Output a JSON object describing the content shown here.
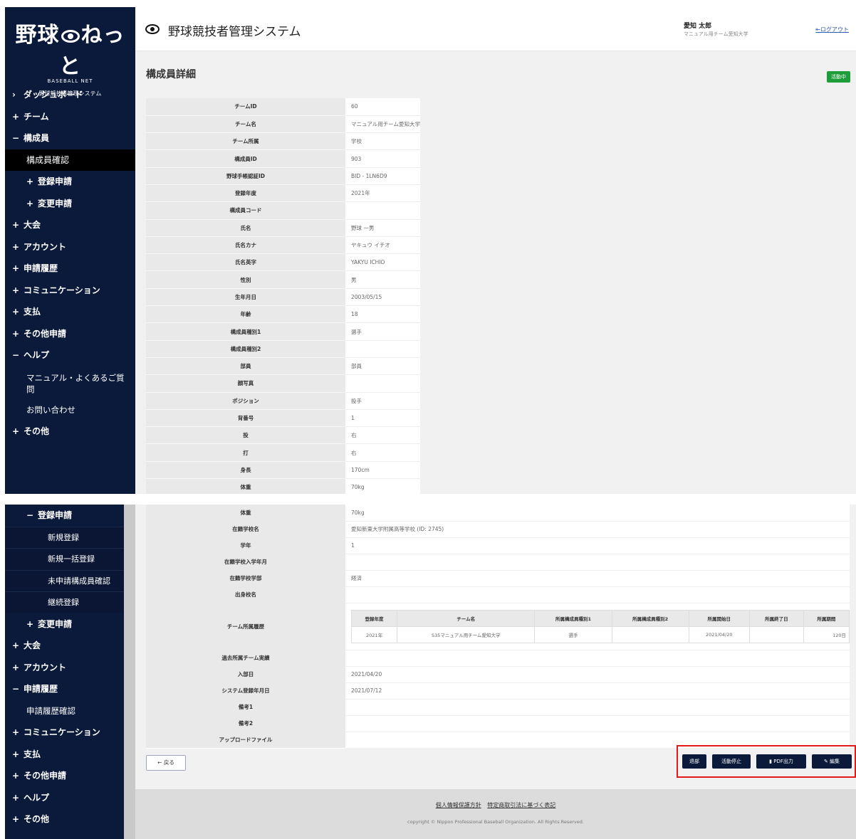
{
  "header": {
    "title": "野球競技者管理システム",
    "user_name": "愛知 太郎",
    "user_team": "マニュアル用チーム愛知大学",
    "logout": "ログアウト"
  },
  "logo": {
    "text": "野球ねっと",
    "sub": "BASEBALL NET",
    "system": "野球競技者管理システム"
  },
  "sidebar_top": [
    {
      "sign": "›",
      "label": "ダッシュボード"
    },
    {
      "sign": "+",
      "label": "チーム"
    },
    {
      "sign": "−",
      "label": "構成員"
    },
    {
      "label": "構成員確認"
    },
    {
      "sign": "+",
      "label": "登録申請"
    },
    {
      "sign": "+",
      "label": "変更申請"
    },
    {
      "sign": "+",
      "label": "大会"
    },
    {
      "sign": "+",
      "label": "アカウント"
    },
    {
      "sign": "+",
      "label": "申請履歴"
    },
    {
      "sign": "+",
      "label": "コミュニケーション"
    },
    {
      "sign": "+",
      "label": "支払"
    },
    {
      "sign": "+",
      "label": "その他申請"
    },
    {
      "sign": "−",
      "label": "ヘルプ"
    },
    {
      "label": "マニュアル・よくあるご質問"
    },
    {
      "label": "お問い合わせ"
    },
    {
      "sign": "+",
      "label": "その他"
    }
  ],
  "sidebar_bottom": [
    {
      "sign": "−",
      "label": "登録申請"
    },
    {
      "label": "新規登録"
    },
    {
      "label": "新規一括登録"
    },
    {
      "label": "未申請構成員確認"
    },
    {
      "label": "継続登録"
    },
    {
      "sign": "+",
      "label": "変更申請"
    },
    {
      "sign": "+",
      "label": "大会"
    },
    {
      "sign": "+",
      "label": "アカウント"
    },
    {
      "sign": "−",
      "label": "申請履歴"
    },
    {
      "label": "申請履歴確認"
    },
    {
      "sign": "+",
      "label": "コミュニケーション"
    },
    {
      "sign": "+",
      "label": "支払"
    },
    {
      "sign": "+",
      "label": "その他申請"
    },
    {
      "sign": "+",
      "label": "ヘルプ"
    },
    {
      "sign": "+",
      "label": "その他"
    }
  ],
  "page": {
    "title": "構成員詳細",
    "status": "活動中"
  },
  "details_top": [
    {
      "label": "チームID",
      "value": "60"
    },
    {
      "label": "チーム名",
      "value": "マニュアル用チーム愛知大学"
    },
    {
      "label": "チーム所属",
      "value": "学校"
    },
    {
      "label": "構成員ID",
      "value": "903"
    },
    {
      "label": "野球手帳認証ID",
      "value": "BID - 1LN6D9"
    },
    {
      "label": "登録年度",
      "value": "2021年"
    },
    {
      "label": "構成員コード",
      "value": ""
    },
    {
      "label": "氏名",
      "value": "野球 一男"
    },
    {
      "label": "氏名カナ",
      "value": "ヤキュウ イチオ"
    },
    {
      "label": "氏名英字",
      "value": "YAKYU ICHIO"
    },
    {
      "label": "性別",
      "value": "男"
    },
    {
      "label": "生年月日",
      "value": "2003/05/15"
    },
    {
      "label": "年齢",
      "value": "18"
    },
    {
      "label": "構成員種別1",
      "value": "選手"
    },
    {
      "label": "構成員種別2",
      "value": ""
    },
    {
      "label": "部員",
      "value": "部員"
    },
    {
      "label": "顔写真",
      "value": ""
    },
    {
      "label": "ポジション",
      "value": "投手"
    },
    {
      "label": "背番号",
      "value": "1"
    },
    {
      "label": "投",
      "value": "右"
    },
    {
      "label": "打",
      "value": "右"
    },
    {
      "label": "身長",
      "value": "170cm"
    },
    {
      "label": "体重",
      "value": "70kg"
    }
  ],
  "details_bottom": [
    {
      "label": "体重",
      "value": "70kg"
    },
    {
      "label": "在籍学校名",
      "value": "愛知新東大学附属高等学校 (ID: 2745)"
    },
    {
      "label": "学年",
      "value": "1"
    },
    {
      "label": "在籍学校入学年月",
      "value": ""
    },
    {
      "label": "在籍学校学部",
      "value": "経済"
    },
    {
      "label": "出身校名",
      "value": ""
    }
  ],
  "history": {
    "label": "チーム所属履歴",
    "columns": [
      "登録年度",
      "チーム名",
      "所属構成員種別1",
      "所属構成員種別2",
      "所属開始日",
      "所属終了日",
      "所属期間"
    ],
    "rows": [
      [
        "2021年",
        "S35マニュアル用チーム愛知大学",
        "選手",
        "",
        "2021/04/20",
        "",
        "120日"
      ]
    ]
  },
  "details_after": [
    {
      "label": "過去所属チーム実績",
      "value": ""
    },
    {
      "label": "入部日",
      "value": "2021/04/20"
    },
    {
      "label": "システム登録年月日",
      "value": "2021/07/12"
    },
    {
      "label": "備考1",
      "value": ""
    },
    {
      "label": "備考2",
      "value": ""
    },
    {
      "label": "アップロードファイル",
      "value": ""
    }
  ],
  "buttons": {
    "back": "← 戻る",
    "transfer": "退部",
    "suspend": "活動停止",
    "pdf": "PDF出力",
    "edit": "編集"
  },
  "footer": {
    "link1": "個人情報保護方針",
    "link2": "特定商取引法に基づく表記",
    "copyright": "copyright © Nippon Professional Baseball Organization. All Rights Reserved."
  },
  "colors": {
    "sidebar": "#0b1a3a",
    "status": "#1e9e3a",
    "highlight": "#e11a1a"
  }
}
